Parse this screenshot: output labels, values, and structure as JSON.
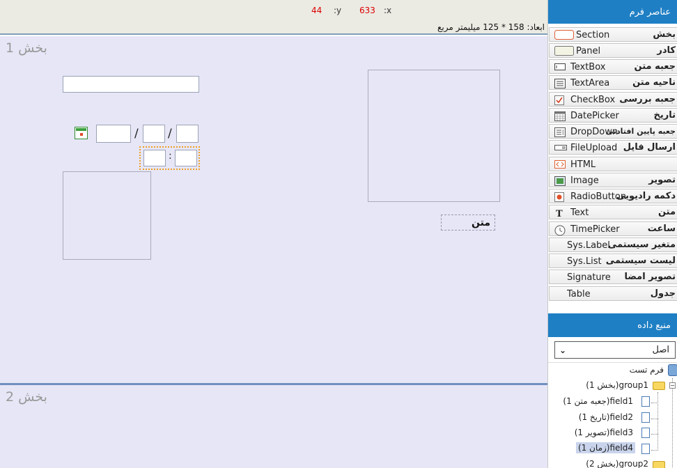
{
  "status": {
    "x_label": ":x",
    "x_value": "633",
    "y_label": ":y",
    "y_value": "44",
    "dimensions": "ابعاد: 158 * 125 میلیمتر مربع"
  },
  "canvas": {
    "section1_title": "بخش 1",
    "section2_title": "بخش 2",
    "date_separator": "/",
    "time_separator": ":",
    "text_label": "متن"
  },
  "panel": {
    "elements_header": "عناصر فرم",
    "tools": [
      {
        "fa": "بخش",
        "en": "Section",
        "icon": "section-icon"
      },
      {
        "fa": "کادر",
        "en": "Panel",
        "icon": "panel-icon"
      },
      {
        "fa": "جعبه متن",
        "en": "TextBox",
        "icon": "textbox-icon"
      },
      {
        "fa": "ناحیه متن",
        "en": "TextArea",
        "icon": "textarea-icon"
      },
      {
        "fa": "جعبه بررسی",
        "en": "CheckBox",
        "icon": "checkbox-icon"
      },
      {
        "fa": "تاریخ",
        "en": "DatePicker",
        "icon": "calendar-icon"
      },
      {
        "fa": "جعبه پایین افتادنی",
        "en": "DropDown",
        "icon": "dropdown-icon"
      },
      {
        "fa": "ارسال فایل",
        "en": "FileUpload",
        "icon": "upload-icon"
      },
      {
        "fa": "",
        "en": "HTML",
        "icon": "html-icon"
      },
      {
        "fa": "تصویر",
        "en": "Image",
        "icon": "image-icon"
      },
      {
        "fa": "دکمه رادیویی",
        "en": "RadioButton",
        "icon": "radio-icon"
      },
      {
        "fa": "متن",
        "en": "Text",
        "icon": "text-icon"
      },
      {
        "fa": "ساعت",
        "en": "TimePicker",
        "icon": "clock-icon"
      },
      {
        "fa": "متغیر سیستمی",
        "en": "Sys.Label",
        "icon": ""
      },
      {
        "fa": "لیست سیستمی",
        "en": "Sys.List",
        "icon": ""
      },
      {
        "fa": "تصویر امضا",
        "en": "Signature",
        "icon": ""
      },
      {
        "fa": "جدول",
        "en": "Table",
        "icon": ""
      }
    ],
    "datasource_header": "منبع داده",
    "datasource_selected": "اصل",
    "tree": {
      "root": "فرم تست",
      "group1": "group1(بخش 1)",
      "fields": [
        "field1(جعبه متن 1)",
        "field2(تاریخ 1)",
        "field3(تصویر 1)",
        "field4(زمان 1)"
      ],
      "group2": "group2(بخش 2)"
    }
  }
}
